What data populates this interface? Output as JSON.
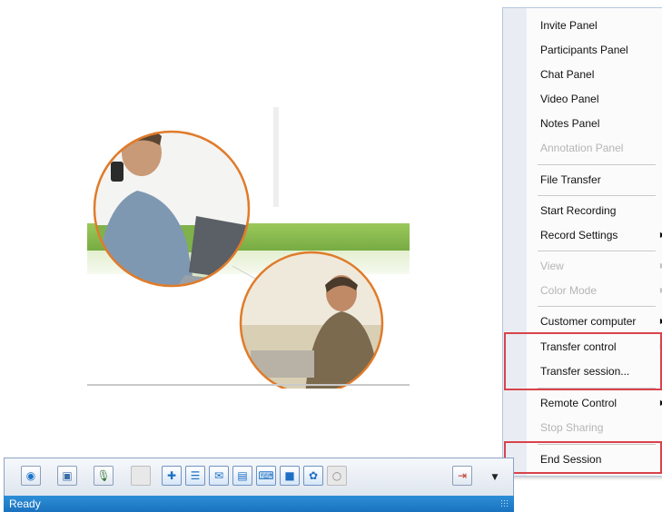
{
  "menu": {
    "items": [
      {
        "label": "Invite Panel",
        "enabled": true
      },
      {
        "label": "Participants Panel",
        "enabled": true
      },
      {
        "label": "Chat Panel",
        "enabled": true
      },
      {
        "label": "Video Panel",
        "enabled": true
      },
      {
        "label": "Notes Panel",
        "enabled": true
      },
      {
        "label": "Annotation Panel",
        "enabled": false
      },
      {
        "label": "File Transfer",
        "enabled": true
      },
      {
        "label": "Start Recording",
        "enabled": true
      },
      {
        "label": "Record Settings",
        "enabled": true,
        "submenu": true
      },
      {
        "label": "View",
        "enabled": false,
        "submenu": true
      },
      {
        "label": "Color Mode",
        "enabled": false,
        "submenu": true
      },
      {
        "label": "Customer computer",
        "enabled": true,
        "submenu": true
      },
      {
        "label": "Transfer control",
        "enabled": true,
        "submenu": true
      },
      {
        "label": "Transfer session...",
        "enabled": true
      },
      {
        "label": "Remote Control",
        "enabled": true,
        "submenu": true
      },
      {
        "label": "Stop Sharing",
        "enabled": false
      },
      {
        "label": "End Session",
        "enabled": true
      }
    ],
    "submenu_arrow": "▶"
  },
  "toolbar": {
    "buttons": [
      {
        "icon": "globe-icon",
        "glyph": "◉",
        "color": "#1e73c8"
      },
      {
        "icon": "monitor-icon",
        "glyph": "▣",
        "color": "#3b6ea8"
      },
      {
        "icon": "microphone-icon",
        "glyph": "🎙",
        "color": "#3a7a3a"
      },
      {
        "icon": "blank-icon",
        "glyph": "",
        "color": "#999999"
      },
      {
        "icon": "invite-icon",
        "glyph": "✚",
        "color": "#1d6fc4"
      },
      {
        "icon": "participants-icon",
        "glyph": "☰",
        "color": "#1d6fc4"
      },
      {
        "icon": "chat-icon",
        "glyph": "✉",
        "color": "#1d6fc4"
      },
      {
        "icon": "notes-icon",
        "glyph": "▤",
        "color": "#1d6fc4"
      },
      {
        "icon": "keyboard-icon",
        "glyph": "⌨",
        "color": "#1d6fc4"
      },
      {
        "icon": "video-icon",
        "glyph": "■",
        "color": "#1d6fc4"
      },
      {
        "icon": "settings-icon",
        "glyph": "✿",
        "color": "#1d6fc4"
      },
      {
        "icon": "record-icon",
        "glyph": "○",
        "color": "#888888"
      }
    ],
    "exit_icon": "exit-icon",
    "exit_glyph": "⇥",
    "dropdown_glyph": "▼"
  },
  "status": {
    "text": "Ready"
  },
  "colors": {
    "highlight": "#d9434b",
    "status_bar": "#1a72bf",
    "circle_border": "#e07b2a",
    "green_band": "#8cc152"
  }
}
